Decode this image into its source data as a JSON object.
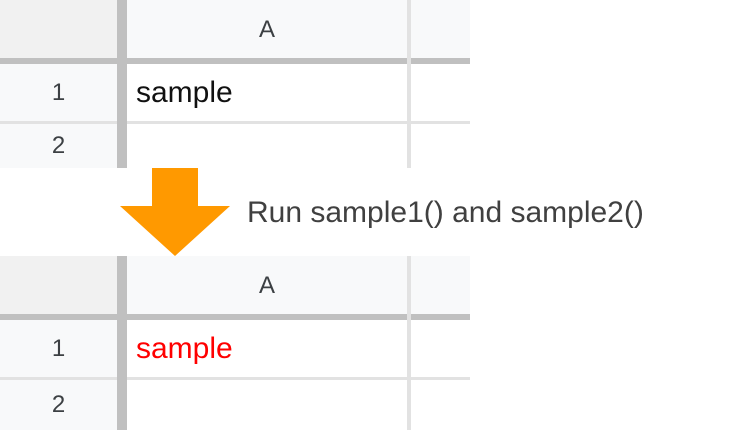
{
  "before": {
    "column_header": "A",
    "rows": [
      {
        "number": "1",
        "value": "sample"
      },
      {
        "number": "2",
        "value": ""
      }
    ]
  },
  "caption": "Run sample1() and sample2()",
  "after": {
    "column_header": "A",
    "rows": [
      {
        "number": "1",
        "value": "sample",
        "color": "#ff0000"
      },
      {
        "number": "2",
        "value": ""
      }
    ]
  },
  "colors": {
    "arrow": "#ff9900",
    "header_bg": "#f8f9fa",
    "corner_bg": "#f1f1f1",
    "thick_gridline": "#c0c0c0",
    "thin_gridline": "#e2e2e2",
    "highlight_text": "#ff0000"
  }
}
